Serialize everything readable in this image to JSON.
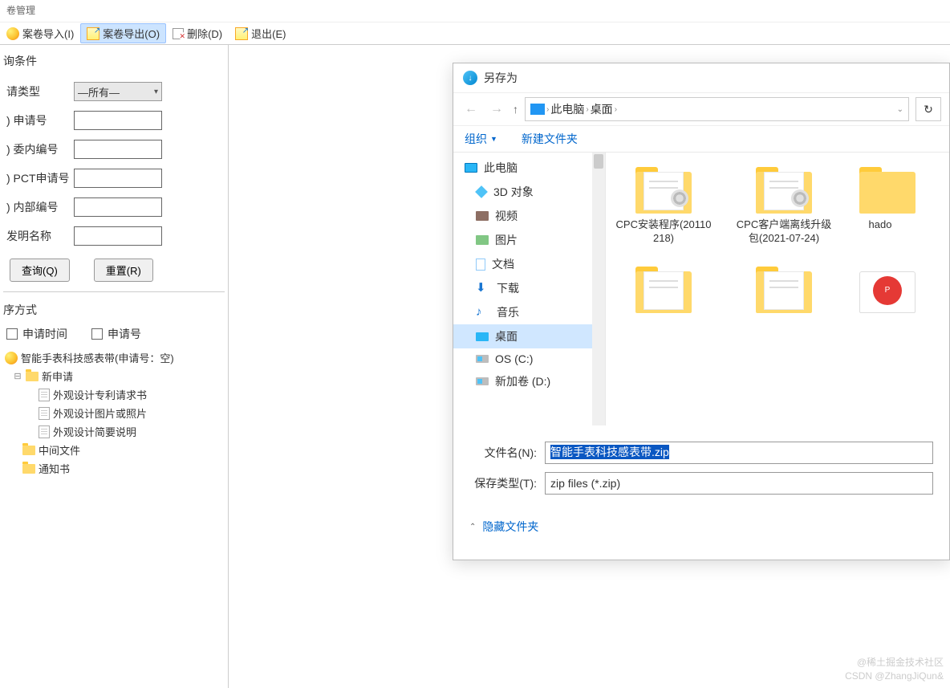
{
  "window": {
    "title": "卷管理"
  },
  "toolbar": {
    "import": "案卷导入(I)",
    "export": "案卷导出(O)",
    "delete": "删除(D)",
    "exit": "退出(E)"
  },
  "filter": {
    "section": "询条件",
    "apply_type_label": "请类型",
    "apply_type_value": "—所有—",
    "apply_no_label": ") 申请号",
    "apply_no_value": "",
    "internal_no_label": ") 委内编号",
    "internal_no_value": "",
    "pct_label": ") PCT申请号",
    "pct_value": "",
    "inner_label": ") 内部编号",
    "inner_value": "",
    "inv_name_label": "发明名称",
    "inv_name_value": "",
    "query_btn": "查询(Q)",
    "reset_btn": "重置(R)"
  },
  "sort": {
    "section": "序方式",
    "cb_time": "申请时间",
    "cb_no": "申请号"
  },
  "tree": {
    "root": "智能手表科技感表带(申请号：空)",
    "new_apply": "新申请",
    "children": [
      "外观设计专利请求书",
      "外观设计图片或照片",
      "外观设计简要说明"
    ],
    "mid_file": "中间文件",
    "notice": "通知书"
  },
  "dialog": {
    "title": "另存为",
    "breadcrumb": {
      "root": "此电脑",
      "child": "桌面"
    },
    "toolbar": {
      "organize": "组织",
      "new_folder": "新建文件夹"
    },
    "sidebar": {
      "this_pc": "此电脑",
      "objects3d": "3D 对象",
      "video": "视频",
      "pictures": "图片",
      "documents": "文档",
      "downloads": "下载",
      "music": "音乐",
      "desktop": "桌面",
      "os": "OS (C:)",
      "new_volume": "新加卷 (D:)"
    },
    "folders": [
      {
        "name": "CPC安装程序(20110218)",
        "type": "gear"
      },
      {
        "name": "CPC客户端离线升级包(2021-07-24)",
        "type": "gear"
      },
      {
        "name": "hado",
        "type": "plain"
      },
      {
        "name": "",
        "type": "plain"
      },
      {
        "name": "",
        "type": "plain"
      },
      {
        "name": "",
        "type": "pdf"
      }
    ],
    "filename_label": "文件名(N):",
    "filename_value": "智能手表科技感表带.zip",
    "filetype_label": "保存类型(T):",
    "filetype_value": "zip files (*.zip)",
    "hide_folders": "隐藏文件夹"
  },
  "watermark": {
    "line1": "@稀土掘金技术社区",
    "line2": "CSDN @ZhangJiQun&"
  }
}
